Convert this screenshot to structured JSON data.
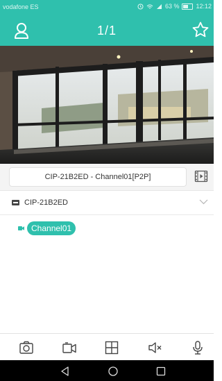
{
  "status_bar": {
    "carrier": "vodafone ES",
    "icons": [
      "alarm-icon",
      "wifi-icon",
      "signal-icon"
    ],
    "battery_percent": "63 %",
    "time": "12:12"
  },
  "header": {
    "title": "1/1",
    "left_icon": "user-icon",
    "right_icon": "star-icon",
    "accent": "#2fc0ad"
  },
  "device_bar": {
    "selected_channel": "CIP-21B2ED - Channel01[P2P]",
    "right_icon": "film-icon"
  },
  "device_list": {
    "device_name": "CIP-21B2ED",
    "channels": [
      {
        "label": "Channel01"
      }
    ]
  },
  "toolbar": {
    "items": [
      "snapshot-icon",
      "record-icon",
      "grid-icon",
      "mute-icon",
      "microphone-icon"
    ]
  },
  "nav_bar": {
    "items": [
      "back-icon",
      "home-icon",
      "recents-icon"
    ]
  }
}
